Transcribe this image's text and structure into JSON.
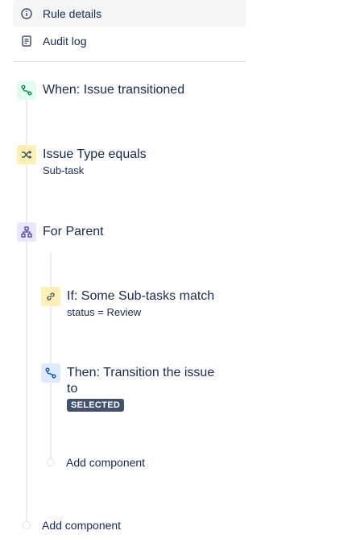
{
  "nav": {
    "rule_details": "Rule details",
    "audit_log": "Audit log"
  },
  "flow": {
    "trigger": {
      "title": "When: Issue transitioned",
      "icon": "transition-icon"
    },
    "condition": {
      "title": "Issue Type equals",
      "subtitle": "Sub-task",
      "icon": "shuffle-icon"
    },
    "branch": {
      "title": "For Parent",
      "icon": "hierarchy-icon"
    },
    "nested": {
      "if_condition": {
        "title": "If: Some Sub-tasks match",
        "subtitle": "status = Review",
        "icon": "link-icon"
      },
      "action": {
        "title_line1": "Then: Transition the issue",
        "title_line2": "to",
        "badge": "SELECTED",
        "icon": "transition-icon"
      },
      "add_component": "Add component"
    },
    "add_component": "Add component"
  },
  "colors": {
    "trigger_bg": "#e3fcef",
    "condition_bg": "#fff0b3",
    "branch_bg": "#eae6ff",
    "action_bg": "#deebff",
    "selected_badge": "#42526e"
  }
}
